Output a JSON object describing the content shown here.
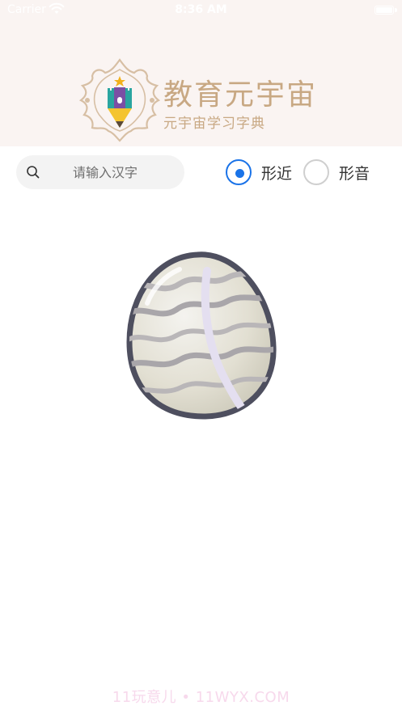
{
  "status_bar": {
    "carrier": "Carrier",
    "time": "8:36 AM",
    "wifi_icon": "wifi-icon",
    "battery_icon": "battery-icon"
  },
  "header": {
    "title": "教育元宇宙",
    "subtitle": "元宇宙学习字典",
    "logo_icon": "castle-pencil-logo",
    "background_color": "#faf4f2",
    "title_color": "#c8a883"
  },
  "search": {
    "placeholder": "请输入汉字",
    "value": "",
    "icon": "search-icon"
  },
  "filter": {
    "options": [
      {
        "label": "形近",
        "selected": true
      },
      {
        "label": "形音",
        "selected": false
      }
    ],
    "accent_color": "#1a73e8"
  },
  "main": {
    "illustration_icon": "egg-icon"
  },
  "watermark": "11玩意儿 • 11WYX.COM"
}
